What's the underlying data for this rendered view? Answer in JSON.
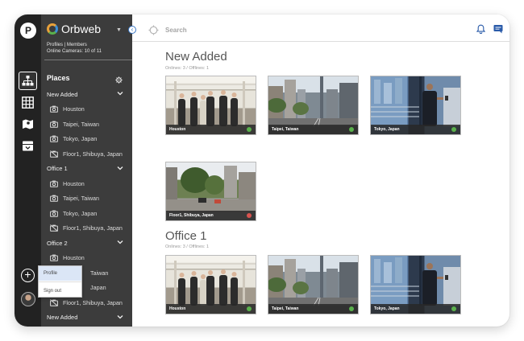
{
  "app": {
    "brand": "Orbweb",
    "rail_logo": "P",
    "subtitle_line1": "Profiles | Members",
    "subtitle_line2": "Online Cameras: 10 of 11"
  },
  "sidebar": {
    "heading": "Places",
    "groups": [
      {
        "label": "New Added",
        "items": [
          "Houston",
          "Taipei, Taiwan",
          "Tokyo, Japan",
          "Floor1, Shibuya, Japan"
        ]
      },
      {
        "label": "Office 1",
        "items": [
          "Houston",
          "Taipei, Taiwan",
          "Tokyo, Japan",
          "Floor1, Shibuya, Japan"
        ]
      },
      {
        "label": "Office 2",
        "items": [
          "Houston",
          "Taiwan",
          "Japan",
          "Floor1, Shibuya, Japan"
        ]
      },
      {
        "label": "New Added"
      }
    ]
  },
  "popup": {
    "profile": "Profile",
    "sign_out": "Sign out"
  },
  "search": {
    "placeholder": "Search"
  },
  "colors": {
    "rail": "#222222",
    "sidebar": "#3c3c3c",
    "online": "#5ab14c",
    "offline": "#d9534f",
    "accent": "#3a77c4"
  },
  "icons": [
    "places-icon",
    "grid-icon",
    "map-icon",
    "archive-icon",
    "gear-icon",
    "camera-icon",
    "camera-offline-icon",
    "bell-icon",
    "chat-icon",
    "search-icon"
  ],
  "sections": [
    {
      "title": "New Added",
      "stats": "Onlines: 3 / Offlines: 1",
      "cameras": [
        {
          "label": "Houston",
          "status": "online"
        },
        {
          "label": "Taipei, Taiwan",
          "status": "online"
        },
        {
          "label": "Tokyo, Japan",
          "status": "online"
        },
        {
          "label": "Floor1, Shibuya, Japan",
          "status": "offline"
        }
      ]
    },
    {
      "title": "Office 1",
      "stats": "Onlines: 3 / Offlines: 1",
      "cameras": [
        {
          "label": "Houston",
          "status": "online"
        },
        {
          "label": "Taipei, Taiwan",
          "status": "online"
        },
        {
          "label": "Tokyo, Japan",
          "status": "online"
        }
      ]
    }
  ]
}
